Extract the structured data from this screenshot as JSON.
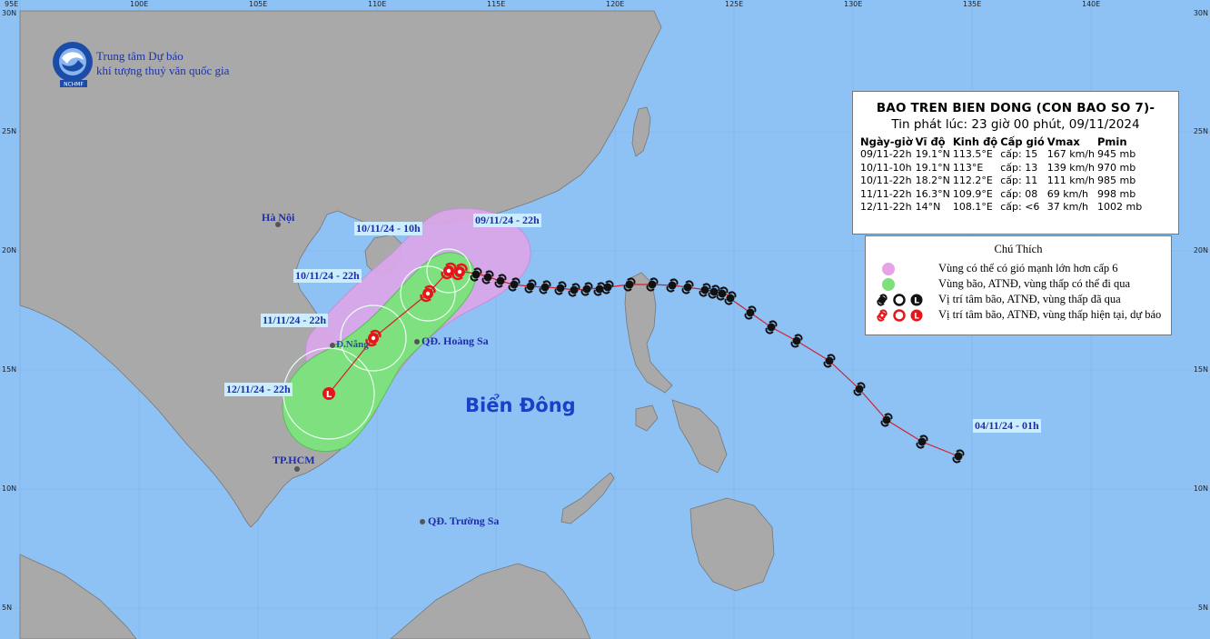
{
  "agency": {
    "line1": "Trung tâm Dự báo",
    "line2": "khí tượng thuỷ văn quốc gia",
    "logo_text": "NCHMF"
  },
  "advisory": {
    "title": "BAO TREN BIEN DONG (CON BAO SO 7)-",
    "issued": "Tin phát lúc: 23 giờ 00 phút, 09/11/2024",
    "headers": [
      "Ngày-giờ",
      "Vĩ độ",
      "Kinh độ",
      "Cấp gió",
      "Vmax",
      "Pmin"
    ],
    "rows": [
      [
        "09/11-22h",
        "19.1°N",
        "113.5°E",
        "cấp: 15",
        "167 km/h",
        "945 mb"
      ],
      [
        "10/11-10h",
        "19.1°N",
        "113°E",
        "cấp: 13",
        "139 km/h",
        "970 mb"
      ],
      [
        "10/11-22h",
        "18.2°N",
        "112.2°E",
        "cấp: 11",
        "111 km/h",
        "985 mb"
      ],
      [
        "11/11-22h",
        "16.3°N",
        "109.9°E",
        "cấp: 08",
        "69 km/h",
        "998 mb"
      ],
      [
        "12/11-22h",
        "14°N",
        "108.1°E",
        "cấp: <6",
        "37 km/h",
        "1002 mb"
      ]
    ]
  },
  "legend": {
    "title": "Chú Thích",
    "items": [
      {
        "text": "Vùng có thể có gió mạnh lớn hơn cấp 6",
        "color": "#e6a3e6"
      },
      {
        "text": "Vùng bão, ATNĐ, vùng thấp có thể đi qua",
        "color": "#7de07d"
      },
      {
        "text": "Vị trí tâm bão, ATNĐ, vùng thấp đã qua",
        "color": "#000000"
      },
      {
        "text": "Vị trí tâm bão, ATNĐ, vùng thấp hiện tại, dự báo",
        "color": "#e8141a"
      }
    ]
  },
  "labels": {
    "hanoi": "Hà Nội",
    "danang": "Đ.Nẵng",
    "hcm": "TP.HCM",
    "hoangsa": "QĐ. Hoàng Sa",
    "truongsa": "QĐ. Trường Sa",
    "sea": "Biển Đông",
    "t1": "10/11/24 - 10h",
    "t2": "09/11/24 - 22h",
    "t3": "10/11/24 - 22h",
    "t4": "11/11/24 - 22h",
    "t5": "12/11/24 - 22h",
    "t6": "04/11/24 - 01h",
    "L": "L"
  },
  "axes": {
    "lon_labels": [
      "95E",
      "100E",
      "105E",
      "110E",
      "115E",
      "120E",
      "125E",
      "130E",
      "135E",
      "140E"
    ],
    "lat_labels": [
      "30N",
      "25N",
      "20N",
      "15N",
      "10N",
      "5N"
    ]
  },
  "colors": {
    "sea": "#8ec2f5",
    "land": "#a9a9a9",
    "wind_zone": "#d9a6e8",
    "storm_zone": "#7ee07e",
    "track_line": "#d1212a",
    "forecast_symbol": "#e8141a"
  }
}
